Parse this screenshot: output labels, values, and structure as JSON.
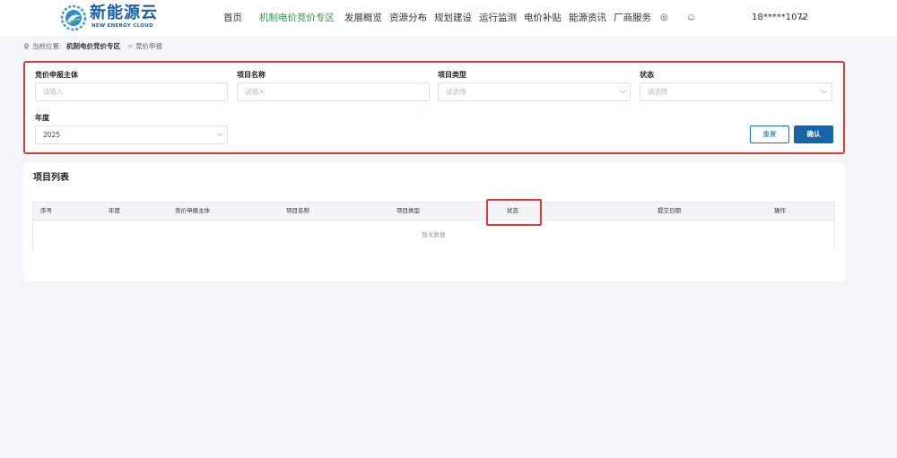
{
  "header": {
    "logo_cn": "新能源云",
    "logo_en": "NEW ENERGY CLOUD",
    "nav": [
      {
        "label": "首页",
        "active": false
      },
      {
        "label": "机制电价竞价专区",
        "active": true
      },
      {
        "label": "发展概览",
        "active": false
      },
      {
        "label": "资源分布",
        "active": false
      },
      {
        "label": "规划建设",
        "active": false
      },
      {
        "label": "运行监测",
        "active": false
      },
      {
        "label": "电价补贴",
        "active": false
      },
      {
        "label": "能源资讯",
        "active": false
      },
      {
        "label": "厂商服务",
        "active": false
      }
    ],
    "icons": [
      "gear-icon",
      "bell-icon"
    ],
    "user": "18*****1072"
  },
  "breadcrumb": {
    "prefix": "当前位置:",
    "zone": "机制电价竞价专区",
    "separator": ">",
    "current": "竞价申报"
  },
  "filters": {
    "subject": {
      "label": "竞价申报主体",
      "placeholder": "请输入"
    },
    "project_name": {
      "label": "项目名称",
      "placeholder": "请输入"
    },
    "project_type": {
      "label": "项目类型",
      "placeholder": "请选择"
    },
    "status": {
      "label": "状态",
      "placeholder": "请选择"
    },
    "year": {
      "label": "年度",
      "value": "2025"
    },
    "reset_label": "重置",
    "confirm_label": "确认"
  },
  "list": {
    "title": "项目列表",
    "columns": [
      "序号",
      "年度",
      "竞价申报主体",
      "项目名称",
      "项目类型",
      "状态",
      "提交日期",
      "操作"
    ],
    "empty_text": "暂无数据"
  },
  "colors": {
    "brand": "#1a5fa8",
    "nav_active": "#2a9d4a",
    "primary_button": "#1565a8",
    "highlight": "#e53935"
  }
}
